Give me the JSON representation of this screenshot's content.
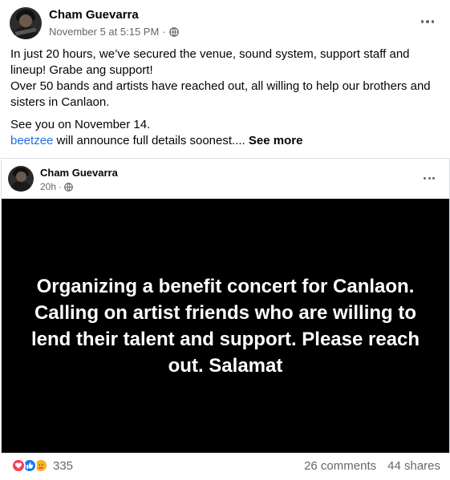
{
  "post": {
    "author": "Cham Guevarra",
    "timestamp": "November 5 at 5:15 PM",
    "separator": "·",
    "audience_icon": "globe-icon",
    "menu_icon": "more-icon",
    "text": {
      "line1": "In just 20 hours, we’ve secured the venue, sound system, support staff and lineup! Grabe ang support!",
      "line2": "Over 50 bands and artists have reached out, all willing to help our brothers and sisters in Canlaon.",
      "line3": "See you on November 14.",
      "mention": "beetzee",
      "line4_rest": " will announce full details soonest.... ",
      "see_more": "See more"
    }
  },
  "shared": {
    "author": "Cham Guevarra",
    "timestamp": "20h",
    "separator": "·",
    "audience_icon": "globe-icon",
    "menu_icon": "more-icon",
    "banner_text": "Organizing a benefit concert for Canlaon. Calling on artist friends who are willing to lend their talent and support. Please reach out. Salamat",
    "banner_bg": "#000000"
  },
  "footer": {
    "reactions": [
      "love-icon",
      "like-icon",
      "care-icon"
    ],
    "reaction_count": "335",
    "comments": "26 comments",
    "shares": "44 shares"
  },
  "colors": {
    "link": "#216fdb",
    "secondary_text": "#65676b",
    "love": "#f33e58",
    "like": "#1877f2",
    "care": "#f7b125"
  }
}
